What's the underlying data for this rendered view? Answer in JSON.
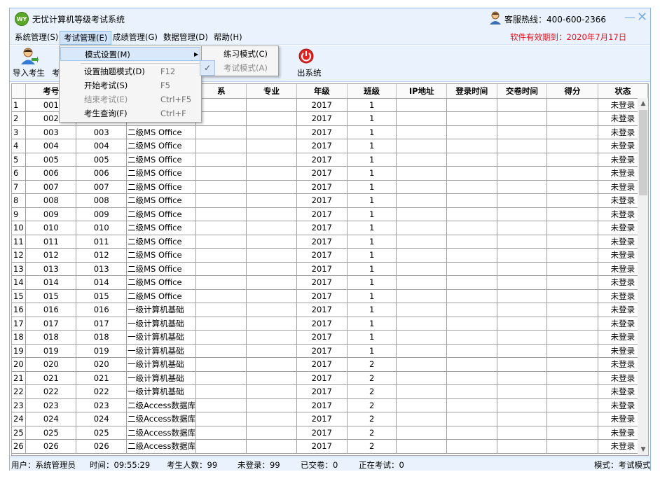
{
  "titlebar": {
    "title": "无忧计算机等级考试系统",
    "logo_text": "WY",
    "hotline": "客服热线：400-600-2366"
  },
  "menu": {
    "items": [
      "系统管理(S)",
      "考试管理(E)",
      "成绩管理(G)",
      "数据管理(D)",
      "帮助(H)"
    ],
    "expiry": "软件有效期到：2020年7月17日"
  },
  "toolbar": {
    "import_label": "导入考生",
    "partial_label": "考",
    "exit_label": "出系统"
  },
  "dropdown": {
    "mode_settings": "模式设置(M)",
    "set_draw_mode": "设置抽题模式(D)",
    "set_draw_shortcut": "F12",
    "start_exam": "开始考试(S)",
    "start_shortcut": "F5",
    "end_exam": "结束考试(E)",
    "end_shortcut": "Ctrl+F5",
    "query_student": "考生查询(F)",
    "query_shortcut": "Ctrl+F"
  },
  "submenu": {
    "practice_mode": "练习模式(C)",
    "exam_mode": "考试模式(A)"
  },
  "table": {
    "headers": [
      "考号",
      "",
      "",
      "系",
      "专业",
      "年级",
      "班级",
      "IP地址",
      "登录时间",
      "交卷时间",
      "得分",
      "状态"
    ],
    "rows": [
      [
        "1",
        "001",
        "",
        "",
        "",
        "",
        "2017",
        "1",
        "",
        "",
        "",
        "",
        "未登录"
      ],
      [
        "2",
        "002",
        "",
        "",
        "",
        "",
        "2017",
        "1",
        "",
        "",
        "",
        "",
        "未登录"
      ],
      [
        "3",
        "003",
        "003",
        "二级MS Office",
        "",
        "",
        "2017",
        "1",
        "",
        "",
        "",
        "",
        "未登录"
      ],
      [
        "4",
        "004",
        "004",
        "二级MS Office",
        "",
        "",
        "2017",
        "1",
        "",
        "",
        "",
        "",
        "未登录"
      ],
      [
        "5",
        "005",
        "005",
        "二级MS Office",
        "",
        "",
        "2017",
        "1",
        "",
        "",
        "",
        "",
        "未登录"
      ],
      [
        "6",
        "006",
        "006",
        "二级MS Office",
        "",
        "",
        "2017",
        "1",
        "",
        "",
        "",
        "",
        "未登录"
      ],
      [
        "7",
        "007",
        "007",
        "二级MS Office",
        "",
        "",
        "2017",
        "1",
        "",
        "",
        "",
        "",
        "未登录"
      ],
      [
        "8",
        "008",
        "008",
        "二级MS Office",
        "",
        "",
        "2017",
        "1",
        "",
        "",
        "",
        "",
        "未登录"
      ],
      [
        "9",
        "009",
        "009",
        "二级MS Office",
        "",
        "",
        "2017",
        "1",
        "",
        "",
        "",
        "",
        "未登录"
      ],
      [
        "10",
        "010",
        "010",
        "二级MS Office",
        "",
        "",
        "2017",
        "1",
        "",
        "",
        "",
        "",
        "未登录"
      ],
      [
        "11",
        "011",
        "011",
        "二级MS Office",
        "",
        "",
        "2017",
        "1",
        "",
        "",
        "",
        "",
        "未登录"
      ],
      [
        "12",
        "012",
        "012",
        "二级MS Office",
        "",
        "",
        "2017",
        "1",
        "",
        "",
        "",
        "",
        "未登录"
      ],
      [
        "13",
        "013",
        "013",
        "二级MS Office",
        "",
        "",
        "2017",
        "1",
        "",
        "",
        "",
        "",
        "未登录"
      ],
      [
        "14",
        "014",
        "014",
        "二级MS Office",
        "",
        "",
        "2017",
        "1",
        "",
        "",
        "",
        "",
        "未登录"
      ],
      [
        "15",
        "015",
        "015",
        "二级MS Office",
        "",
        "",
        "2017",
        "1",
        "",
        "",
        "",
        "",
        "未登录"
      ],
      [
        "16",
        "016",
        "016",
        "一级计算机基础",
        "",
        "",
        "2017",
        "1",
        "",
        "",
        "",
        "",
        "未登录"
      ],
      [
        "17",
        "017",
        "017",
        "一级计算机基础",
        "",
        "",
        "2017",
        "1",
        "",
        "",
        "",
        "",
        "未登录"
      ],
      [
        "18",
        "018",
        "018",
        "一级计算机基础",
        "",
        "",
        "2017",
        "1",
        "",
        "",
        "",
        "",
        "未登录"
      ],
      [
        "19",
        "019",
        "019",
        "一级计算机基础",
        "",
        "",
        "2017",
        "1",
        "",
        "",
        "",
        "",
        "未登录"
      ],
      [
        "20",
        "020",
        "020",
        "一级计算机基础",
        "",
        "",
        "2017",
        "2",
        "",
        "",
        "",
        "",
        "未登录"
      ],
      [
        "21",
        "021",
        "021",
        "一级计算机基础",
        "",
        "",
        "2017",
        "2",
        "",
        "",
        "",
        "",
        "未登录"
      ],
      [
        "22",
        "022",
        "022",
        "一级计算机基础",
        "",
        "",
        "2017",
        "2",
        "",
        "",
        "",
        "",
        "未登录"
      ],
      [
        "23",
        "023",
        "023",
        "二级Access数据库",
        "",
        "",
        "2017",
        "2",
        "",
        "",
        "",
        "",
        "未登录"
      ],
      [
        "24",
        "024",
        "024",
        "二级Access数据库",
        "",
        "",
        "2017",
        "2",
        "",
        "",
        "",
        "",
        "未登录"
      ],
      [
        "25",
        "025",
        "025",
        "二级Access数据库",
        "",
        "",
        "2017",
        "2",
        "",
        "",
        "",
        "",
        "未登录"
      ],
      [
        "26",
        "026",
        "026",
        "二级Access数据库",
        "",
        "",
        "2017",
        "2",
        "",
        "",
        "",
        "",
        "未登录"
      ]
    ]
  },
  "statusbar": {
    "user": "用户：系统管理员",
    "time": "时间：09:55:29",
    "total": "考生人数：99",
    "not_logged": "未登录：99",
    "submitted": "已交卷：0",
    "in_exam": "正在考试：0",
    "mode": "模式：考试模式"
  },
  "colors": {
    "accent": "#eaf3fd",
    "border": "#8fb8e6",
    "expiry_red": "#e8101c",
    "exit_red": "#e02424"
  }
}
